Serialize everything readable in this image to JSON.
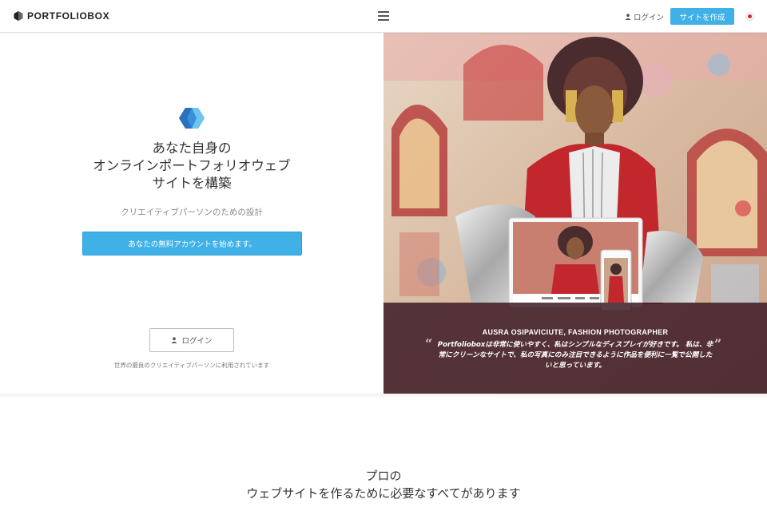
{
  "header": {
    "brand": "PORTFOLIOBOX",
    "login_label": "ログイン",
    "create_label": "サイトを作成",
    "language_flag": "jp-flag-icon"
  },
  "hero": {
    "title_lines": [
      "あなた自身の",
      "オンラインポートフォリオウェブ",
      "サイトを構築"
    ],
    "subtitle": "クリエイティブパーソンのための設計",
    "cta_label": "あなたの無料アカウントを始めます。",
    "login_label": "ログイン",
    "trusted_text": "世界の最良のクリエイティブパーソンに利用されています"
  },
  "testimonial": {
    "author": "AUSRA OSIPAVICIUTE, FASHION PHOTOGRAPHER",
    "quote": "Portfolioboxは非常に使いやすく、私はシンプルなディスプレイが好きです。 私は、非常にクリーンなサイトで、私の写真にのみ注目できるように作品を便利に一覧で公開したいと思っています。",
    "open_mark": "“",
    "close_mark": "”"
  },
  "section2": {
    "title_lines": [
      "プロの",
      "ウェブサイトを作るために必要なすべてがあります"
    ]
  },
  "colors": {
    "accent": "#3fb1e6",
    "overlay": "#3e1c26"
  }
}
